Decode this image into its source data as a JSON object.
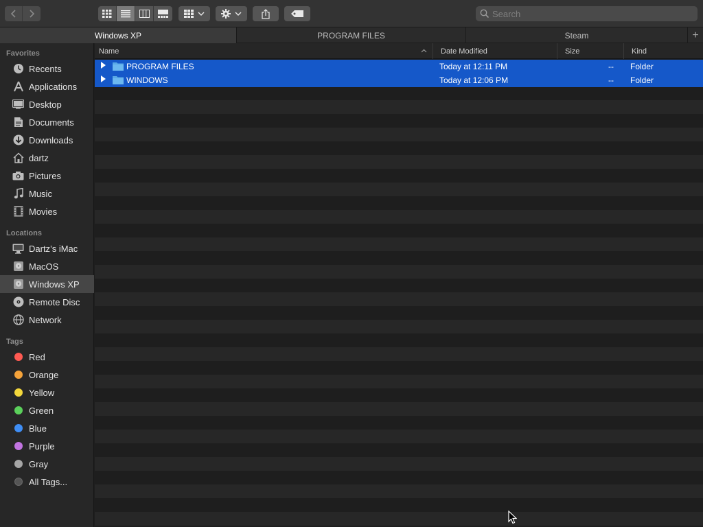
{
  "toolbar": {
    "back_icon": "chevron-left-icon",
    "forward_icon": "chevron-right-icon",
    "view_modes": [
      "icon-view-icon",
      "list-view-icon",
      "column-view-icon",
      "gallery-view-icon"
    ],
    "active_view": "list-view-icon",
    "group_icon": "group-grid-icon",
    "action_icon": "gear-icon",
    "share_icon": "share-icon",
    "tag_icon": "tag-icon",
    "search_placeholder": "Search"
  },
  "tabs": [
    {
      "label": "Windows XP",
      "active": true
    },
    {
      "label": "PROGRAM FILES",
      "active": false
    },
    {
      "label": "Steam",
      "active": false
    }
  ],
  "tab_add_label": "+",
  "sidebar": {
    "favorites_title": "Favorites",
    "favorites": [
      {
        "label": "Recents",
        "icon": "clock-icon"
      },
      {
        "label": "Applications",
        "icon": "applications-icon"
      },
      {
        "label": "Desktop",
        "icon": "desktop-icon"
      },
      {
        "label": "Documents",
        "icon": "document-icon"
      },
      {
        "label": "Downloads",
        "icon": "download-icon"
      },
      {
        "label": "dartz",
        "icon": "home-icon"
      },
      {
        "label": "Pictures",
        "icon": "camera-icon"
      },
      {
        "label": "Music",
        "icon": "music-note-icon"
      },
      {
        "label": "Movies",
        "icon": "film-icon"
      }
    ],
    "locations_title": "Locations",
    "locations": [
      {
        "label": "Dartz’s iMac",
        "icon": "imac-icon"
      },
      {
        "label": "MacOS",
        "icon": "hard-drive-icon"
      },
      {
        "label": "Windows XP",
        "icon": "hard-drive-icon",
        "selected": true
      },
      {
        "label": "Remote Disc",
        "icon": "disc-icon"
      },
      {
        "label": "Network",
        "icon": "globe-icon"
      }
    ],
    "tags_title": "Tags",
    "tags": [
      {
        "label": "Red",
        "color": "#ff5a52"
      },
      {
        "label": "Orange",
        "color": "#f5a33a"
      },
      {
        "label": "Yellow",
        "color": "#f4d83c"
      },
      {
        "label": "Green",
        "color": "#5bd05b"
      },
      {
        "label": "Blue",
        "color": "#3f8ef5"
      },
      {
        "label": "Purple",
        "color": "#c174e0"
      },
      {
        "label": "Gray",
        "color": "#a6a6a6"
      },
      {
        "label": "All Tags...",
        "color": "#555555"
      }
    ]
  },
  "columns": {
    "name": "Name",
    "date_modified": "Date Modified",
    "size": "Size",
    "kind": "Kind",
    "sort_icon": "chevron-up-icon"
  },
  "files": [
    {
      "name": "PROGRAM FILES",
      "date": "Today at 12:11 PM",
      "size": "--",
      "kind": "Folder"
    },
    {
      "name": "WINDOWS",
      "date": "Today at 12:06 PM",
      "size": "--",
      "kind": "Folder"
    }
  ],
  "colors": {
    "selection": "#1558c9",
    "folder": "#5aa9e6"
  }
}
